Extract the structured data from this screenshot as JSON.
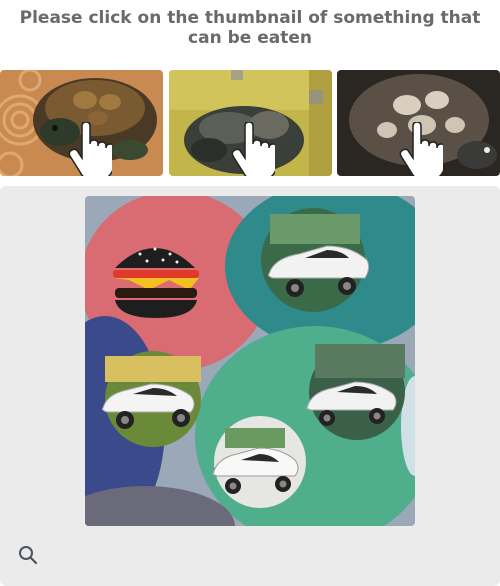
{
  "prompt": {
    "text": "Please click on the thumbnail of something that can be eaten"
  },
  "thumbnails": [
    {
      "subject": "turtle",
      "icon": "hand-cursor-icon"
    },
    {
      "subject": "turtle",
      "icon": "hand-cursor-icon"
    },
    {
      "subject": "turtle",
      "icon": "hand-cursor-icon"
    }
  ],
  "challenge": {
    "objects": [
      "hamburger",
      "car",
      "car",
      "car",
      "car"
    ]
  },
  "toolbar": {
    "zoom_icon": "magnifier-icon"
  },
  "colors": {
    "prompt_text": "#6a6a6a",
    "panel_bg": "#ebebeb",
    "icon": "#4a5460"
  }
}
